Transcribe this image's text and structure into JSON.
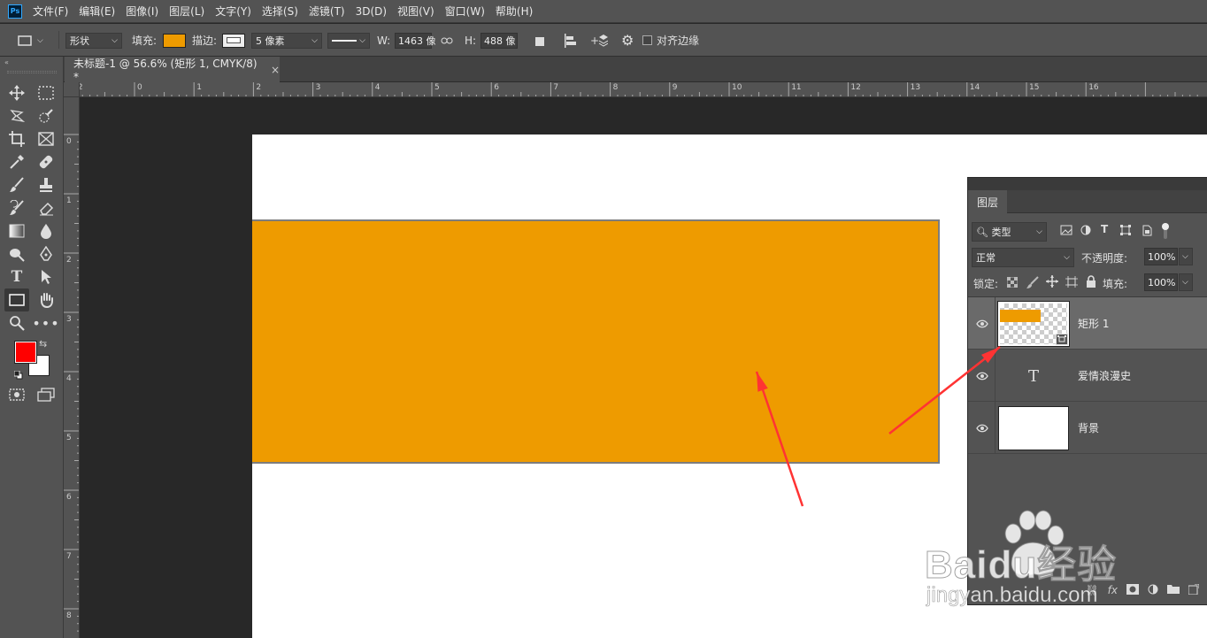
{
  "app": {
    "logo": "Ps"
  },
  "menu": [
    "文件(F)",
    "编辑(E)",
    "图像(I)",
    "图层(L)",
    "文字(Y)",
    "选择(S)",
    "滤镜(T)",
    "3D(D)",
    "视图(V)",
    "窗口(W)",
    "帮助(H)"
  ],
  "options": {
    "mode": "形状",
    "fill_label": "填充:",
    "fill_color": "#ee9b00",
    "stroke_label": "描边:",
    "stroke_width": "5 像素",
    "w_label": "W:",
    "w_value": "1463 像",
    "h_label": "H:",
    "h_value": "488 像",
    "align_edges": "对齐边缘"
  },
  "document_tab": {
    "title": "未标题-1 @ 56.6% (矩形 1, CMYK/8) *",
    "close": "×"
  },
  "ruler_h_labels": [
    "2",
    "0",
    "2",
    "4",
    "6",
    "8",
    "10",
    "12",
    "14",
    "16",
    "18",
    "20",
    "22",
    "24",
    "26",
    "28",
    "30",
    "32"
  ],
  "ruler_h_labels_shown": [
    "2",
    "0",
    "1",
    "2",
    "3",
    "4",
    "5",
    "6",
    "7",
    "8",
    "9",
    "10",
    "11",
    "12",
    "13",
    "14",
    "15",
    "16"
  ],
  "ruler_v_labels": [
    "0",
    "1",
    "2",
    "3",
    "4",
    "5",
    "6",
    "7",
    "8"
  ],
  "colors": {
    "foreground": "#ff0000",
    "background": "#ffffff",
    "shape": "#ee9b00",
    "arrow": "#ff3333"
  },
  "layers_panel": {
    "tab": "图层",
    "filter_kind": "类型",
    "blend_mode": "正常",
    "opacity_label": "不透明度:",
    "opacity_value": "100%",
    "lock_label": "锁定:",
    "fill_label": "填充:",
    "fill_value": "100%",
    "layers": [
      {
        "name": "矩形 1",
        "type": "shape",
        "selected": true
      },
      {
        "name": "爱情浪漫史",
        "type": "text",
        "selected": false
      },
      {
        "name": "背景",
        "type": "background",
        "selected": false
      }
    ],
    "footer_fx": "fx"
  },
  "watermark": {
    "brand": "Baidu经验",
    "url": "jingyan.baidu.com"
  }
}
